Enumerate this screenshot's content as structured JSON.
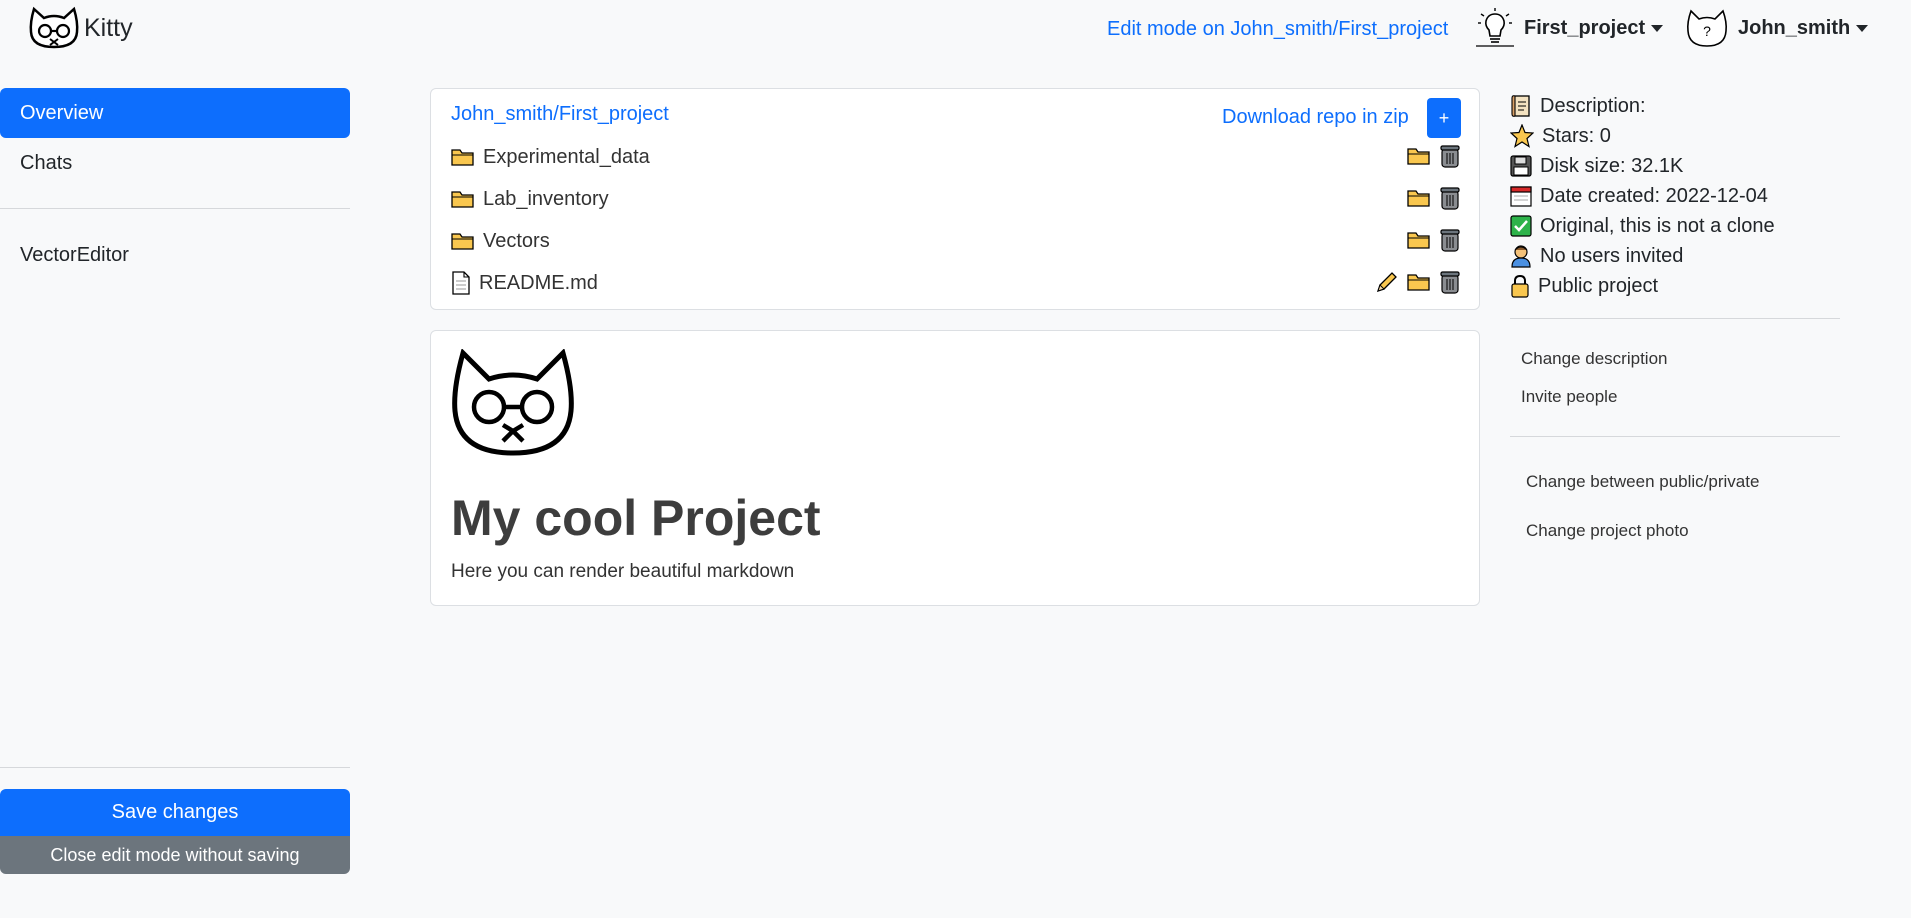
{
  "brand": {
    "name": "Kitty"
  },
  "header": {
    "edit_mode": "Edit mode on John_smith/First_project",
    "project_label": "First_project",
    "user_label": "John_smith"
  },
  "sidebar": {
    "items": [
      {
        "label": "Overview",
        "active": true
      },
      {
        "label": "Chats"
      },
      {
        "label": "VectorEditor"
      }
    ],
    "save_label": "Save changes",
    "close_label": "Close edit mode without saving"
  },
  "repo": {
    "path": "John_smith/First_project",
    "download_label": "Download repo in zip",
    "add_label": "+",
    "files": [
      {
        "name": "Experimental_data",
        "type": "folder"
      },
      {
        "name": "Lab_inventory",
        "type": "folder"
      },
      {
        "name": "Vectors",
        "type": "folder"
      },
      {
        "name": "README.md",
        "type": "file"
      }
    ]
  },
  "readme": {
    "title": "My cool Project",
    "text": "Here you can render beautiful markdown"
  },
  "info": {
    "description": "Description:",
    "stars": "Stars: 0",
    "disk": "Disk size: 32.1K",
    "created": "Date created: 2022-12-04",
    "origin": "Original, this is not a clone",
    "users": "No users invited",
    "visibility": "Public project"
  },
  "actions": {
    "change_description": "Change description",
    "invite_people": "Invite people",
    "change_visibility": "Change between public/private",
    "change_photo": "Change project photo"
  },
  "colors": {
    "primary": "#0d6efd",
    "secondary": "#6c757d",
    "folder": "#f9c74f"
  }
}
